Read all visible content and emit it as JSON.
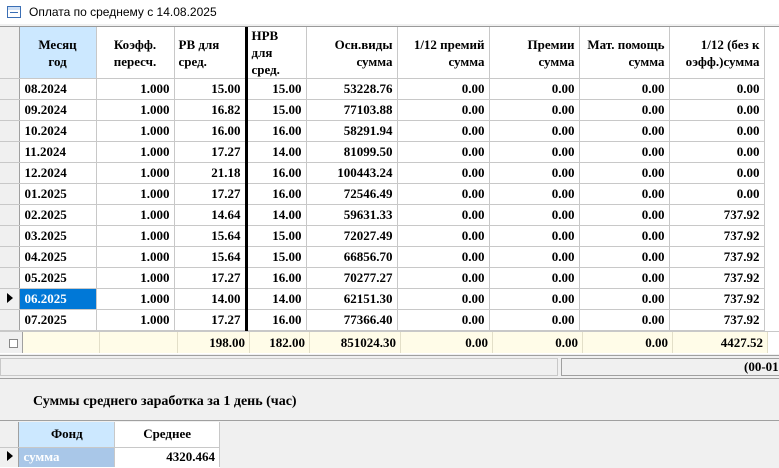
{
  "window": {
    "title": "Оплата по среднему с 14.08.2025"
  },
  "main_table": {
    "headers": [
      "Месяц\nгод",
      "Коэфф.\nпересч.",
      "РВ для\nсред.",
      "НРВ для\nсред.",
      "Осн.виды\nсумма",
      "1/12 премий\nсумма",
      "Премии\nсумма",
      "Мат. помощь\nсумма",
      "1/12 (без к\nоэфф.)сумма"
    ],
    "rows": [
      [
        "08.2024",
        "1.000",
        "15.00",
        "15.00",
        "53228.76",
        "0.00",
        "0.00",
        "0.00",
        "0.00"
      ],
      [
        "09.2024",
        "1.000",
        "16.82",
        "15.00",
        "77103.88",
        "0.00",
        "0.00",
        "0.00",
        "0.00"
      ],
      [
        "10.2024",
        "1.000",
        "16.00",
        "16.00",
        "58291.94",
        "0.00",
        "0.00",
        "0.00",
        "0.00"
      ],
      [
        "11.2024",
        "1.000",
        "17.27",
        "14.00",
        "81099.50",
        "0.00",
        "0.00",
        "0.00",
        "0.00"
      ],
      [
        "12.2024",
        "1.000",
        "21.18",
        "16.00",
        "100443.24",
        "0.00",
        "0.00",
        "0.00",
        "0.00"
      ],
      [
        "01.2025",
        "1.000",
        "17.27",
        "16.00",
        "72546.49",
        "0.00",
        "0.00",
        "0.00",
        "0.00"
      ],
      [
        "02.2025",
        "1.000",
        "14.64",
        "14.00",
        "59631.33",
        "0.00",
        "0.00",
        "0.00",
        "737.92"
      ],
      [
        "03.2025",
        "1.000",
        "15.64",
        "15.00",
        "72027.49",
        "0.00",
        "0.00",
        "0.00",
        "737.92"
      ],
      [
        "04.2025",
        "1.000",
        "15.64",
        "15.00",
        "66856.70",
        "0.00",
        "0.00",
        "0.00",
        "737.92"
      ],
      [
        "05.2025",
        "1.000",
        "17.27",
        "16.00",
        "70277.27",
        "0.00",
        "0.00",
        "0.00",
        "737.92"
      ],
      [
        "06.2025",
        "1.000",
        "14.00",
        "14.00",
        "62151.30",
        "0.00",
        "0.00",
        "0.00",
        "737.92"
      ],
      [
        "07.2025",
        "1.000",
        "17.27",
        "16.00",
        "77366.40",
        "0.00",
        "0.00",
        "0.00",
        "737.92"
      ]
    ],
    "selected_row": 10,
    "totals": [
      "",
      "",
      "198.00",
      "182.00",
      "851024.30",
      "0.00",
      "0.00",
      "0.00",
      "4427.52"
    ]
  },
  "status": {
    "right_text": "(00-01"
  },
  "section": {
    "title": "Суммы среднего заработка за 1 день (час)"
  },
  "avg_table": {
    "headers": [
      "Фонд",
      "Среднее"
    ],
    "rows": [
      [
        "сумма",
        "4320.464"
      ]
    ]
  },
  "colors": {
    "selection": "#0078d7",
    "header_selected": "#cce8ff",
    "totals_bg": "#fffce8"
  }
}
